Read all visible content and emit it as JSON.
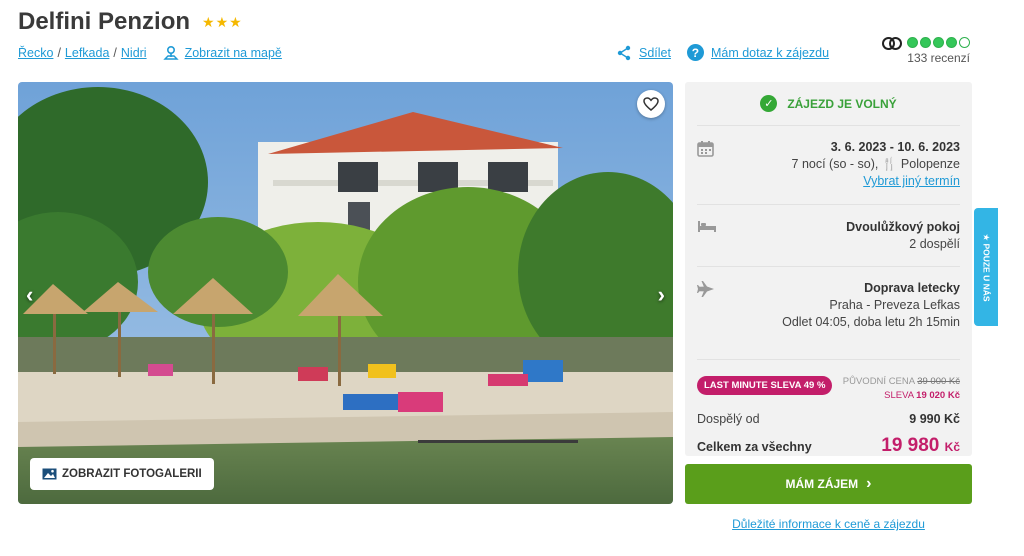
{
  "hotel": {
    "name": "Delfini Penzion",
    "stars": "★★★"
  },
  "breadcrumb": {
    "country": "Řecko",
    "region": "Lefkada",
    "place": "Nidri",
    "map_link": "Zobrazit na mapě"
  },
  "actions": {
    "share": "Sdílet",
    "ask": "Mám dotaz k zájezdu",
    "ask_icon": "?"
  },
  "rating": {
    "count": "133 recenzí",
    "score_dots": 4,
    "max_dots": 5
  },
  "gallery": {
    "button": "ZOBRAZIT FOTOGALERII",
    "prev": "‹",
    "next": "›"
  },
  "panel": {
    "status": "ZÁJEZD JE VOLNÝ",
    "dates": "3. 6. 2023 - 10. 6. 2023",
    "nights": "7 nocí (so - so),",
    "board": "Polopenze",
    "change_date": "Vybrat jiný termín",
    "room": "Dvoulůžkový pokoj",
    "persons": "2 dospělí",
    "transport": "Doprava letecky",
    "route": "Praha - Preveza Lefkas",
    "flight_info": "Odlet 04:05, doba letu 2h 15min",
    "discount_badge": "LAST MINUTE SLEVA 49 %",
    "orig_label": "PŮVODNÍ CENA",
    "orig_price": "39 000 Kč",
    "sleva_label": "SLEVA",
    "sleva_value": "19 020 Kč",
    "adult_label": "Dospělý od",
    "adult_price": "9 990 Kč",
    "total_label": "Celkem za všechny",
    "total_price": "19 980",
    "total_currency": "Kč"
  },
  "cta": {
    "label": "MÁM ZÁJEM",
    "arrow": "›"
  },
  "info_link": "Důležité informace k ceně a zájezdu",
  "side_tab": "★ POUZE U NÁS",
  "colors": {
    "accent_blue": "#1f9ad6",
    "green": "#5a9e1b",
    "magenta": "#c31e6a",
    "star": "#f5b800"
  }
}
